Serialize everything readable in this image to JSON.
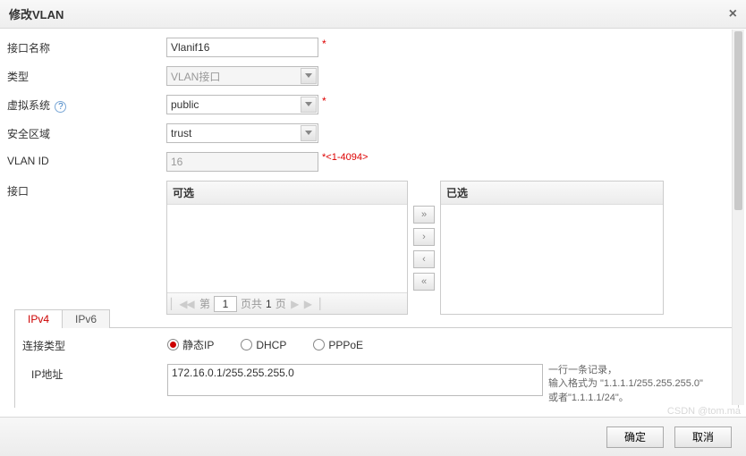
{
  "dialog": {
    "title": "修改VLAN",
    "close": "×"
  },
  "form": {
    "ifname": {
      "label": "接口名称",
      "value": "Vlanif16"
    },
    "type": {
      "label": "类型",
      "value": "VLAN接口"
    },
    "vsys": {
      "label": "虚拟系统",
      "value": "public"
    },
    "zone": {
      "label": "安全区域",
      "value": "trust"
    },
    "vlanid": {
      "label": "VLAN ID",
      "value": "16",
      "hint": "*<1-4094>"
    },
    "if": {
      "label": "接口"
    }
  },
  "dual": {
    "left_title": "可选",
    "right_title": "已选",
    "pager": {
      "prefix": "第",
      "page": "1",
      "suffix_a": "页共",
      "total": "1",
      "suffix_b": "页"
    }
  },
  "tabs": {
    "ipv4": "IPv4",
    "ipv6": "IPv6"
  },
  "ip": {
    "conn_label": "连接类型",
    "static": "静态IP",
    "dhcp": "DHCP",
    "pppoe": "PPPoE",
    "addr_label": "IP地址",
    "addr_value": "172.16.0.1/255.255.255.0",
    "hint1": "一行一条记录，",
    "hint2": "输入格式为 \"1.1.1.1/255.255.255.0\"",
    "hint3": "或者\"1.1.1.1/24\"。"
  },
  "buttons": {
    "ok": "确定",
    "cancel": "取消"
  },
  "watermark": "CSDN @tom.ma"
}
